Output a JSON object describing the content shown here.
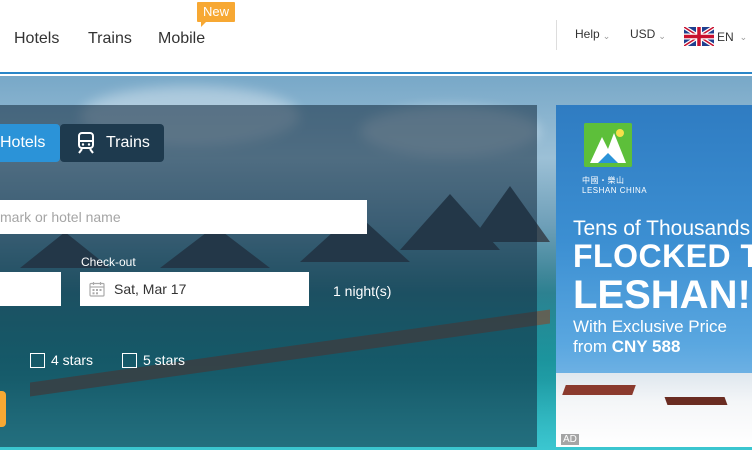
{
  "header": {
    "nav": [
      {
        "label": "Hotels"
      },
      {
        "label": "Trains"
      },
      {
        "label": "Mobile"
      }
    ],
    "new_badge": "New",
    "help": "Help",
    "currency": "USD",
    "language": "EN",
    "accent_color": "#2b93d8",
    "badge_color": "#f7a833"
  },
  "search": {
    "tabs": [
      {
        "label": "Hotels",
        "active": true
      },
      {
        "label": "Trains",
        "active": false
      }
    ],
    "destination_placeholder": "mark or hotel name",
    "checkout_label": "Check-out",
    "checkout_value": "Sat, Mar 17",
    "nights": "1 night(s)",
    "star_options": [
      {
        "label": "4 stars",
        "checked": false
      },
      {
        "label": "5 stars",
        "checked": false
      }
    ],
    "icons": [
      "train-icon",
      "calendar-icon",
      "chevron-down-icon",
      "uk-flag-icon"
    ]
  },
  "ad": {
    "logo_text": "中國・樂山",
    "logo_subtext": "LESHAN CHINA",
    "line1": "Tens of Thousands o",
    "line2": "FLOCKED TO",
    "line3": "LESHAN!",
    "line4": "With Exclusive Price",
    "line5_prefix": "from ",
    "line5_price": "CNY 588",
    "tag": "AD"
  }
}
